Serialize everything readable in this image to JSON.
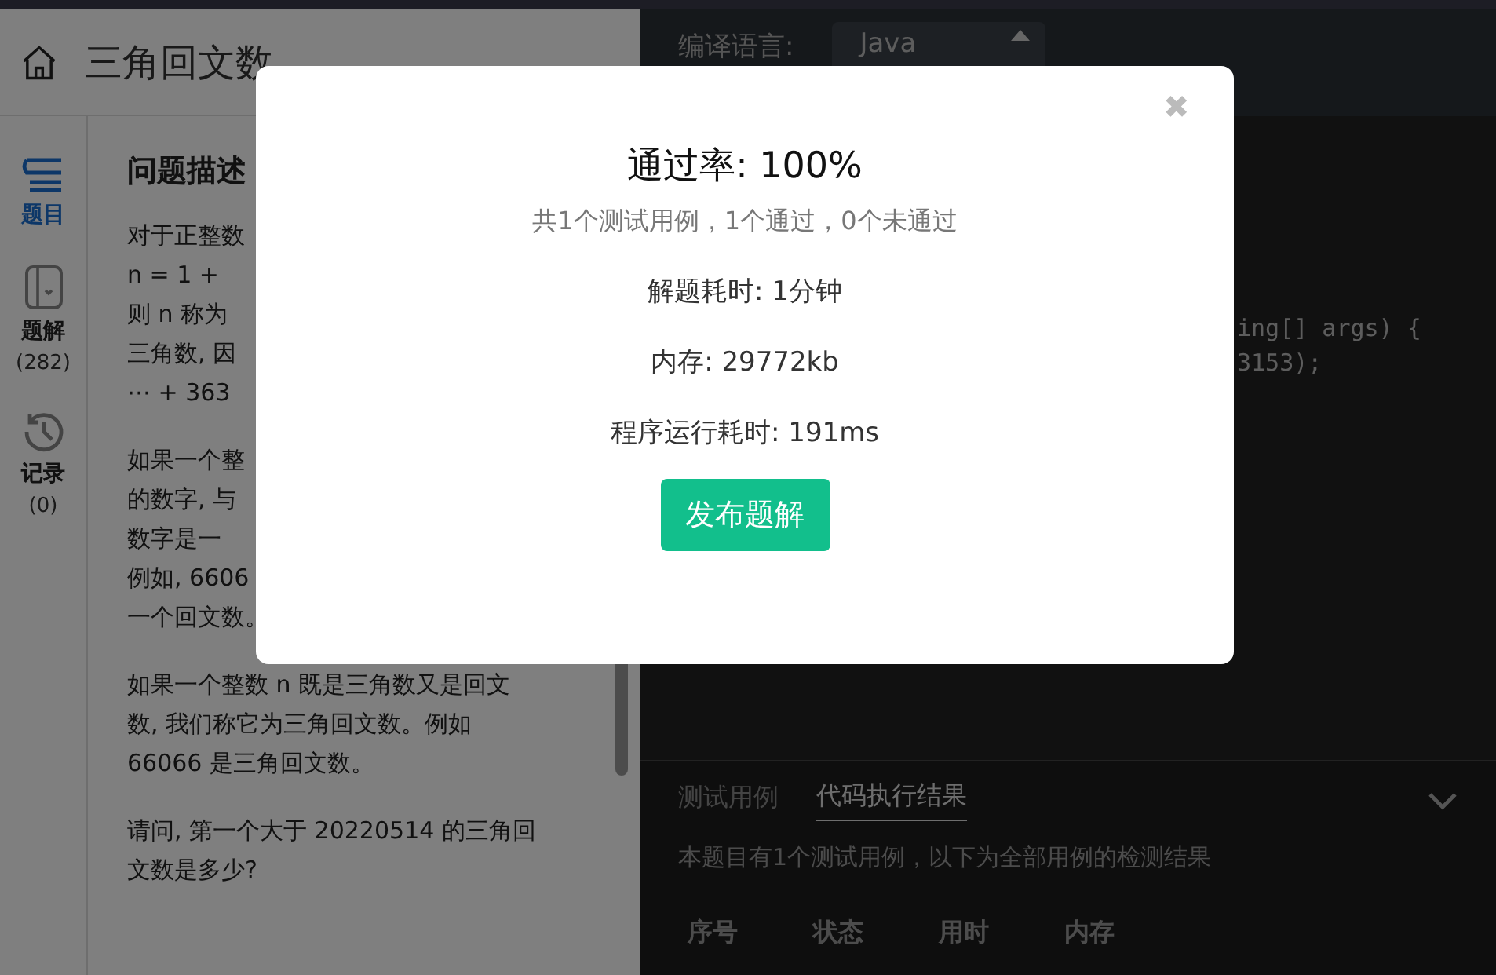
{
  "problem": {
    "title": "三角回文数",
    "heading": "问题描述",
    "paragraphs": [
      [
        "对于正整数",
        "n = 1 +",
        "则 n 称为",
        "三角数, 因",
        "⋯ + 363"
      ],
      [
        "如果一个整",
        "的数字, 与",
        "数字是一",
        "例如, 6606",
        "一个回文数。"
      ],
      [
        "如果一个整数 n 既是三角数又是回文",
        "数, 我们称它为三角回文数。例如",
        "66066 是三角回文数。"
      ],
      [
        "请问, 第一个大于 20220514 的三角回",
        "文数是多少?"
      ]
    ]
  },
  "sidebar": {
    "items": [
      {
        "kind": "list",
        "label": "题目",
        "selected": true
      },
      {
        "kind": "book",
        "label": "题解",
        "count": "(282)",
        "selected": false
      },
      {
        "kind": "history",
        "label": "记录",
        "count": "(0)",
        "selected": false
      }
    ]
  },
  "editor": {
    "language_label": "编译语言:",
    "language": "Java",
    "code_lines": [
      "ing[] args) {",
      "3153);"
    ]
  },
  "results": {
    "tabs": [
      {
        "label": "测试用例",
        "selected": false
      },
      {
        "label": "代码执行结果",
        "selected": true
      }
    ],
    "summary": "本题目有1个测试用例，以下为全部用例的检测结果",
    "columns": [
      "序号",
      "状态",
      "用时",
      "内存"
    ]
  },
  "dialog": {
    "close": "✖",
    "title": "通过率: 100%",
    "subtitle": "共1个测试用例，1个通过，0个未通过",
    "stats": [
      "解题耗时: 1分钟",
      "内存: 29772kb",
      "程序运行耗时: 191ms"
    ],
    "button": "发布题解"
  }
}
